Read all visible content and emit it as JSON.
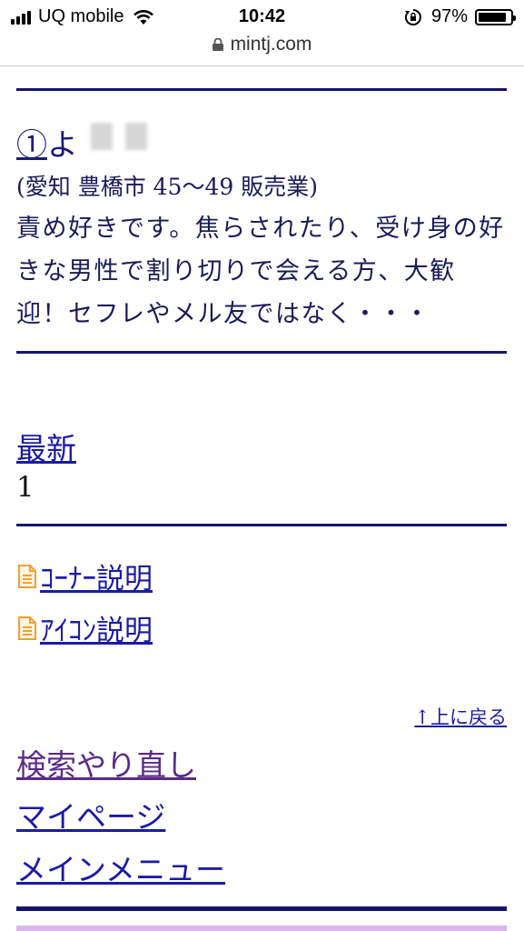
{
  "status_bar": {
    "carrier": "UQ mobile",
    "time": "10:42",
    "battery_percent": "97%",
    "battery_level": 0.97,
    "icons": [
      "signal-icon",
      "wifi-icon",
      "rotation-lock-icon",
      "battery-icon"
    ]
  },
  "browser": {
    "url": "mintj.com",
    "icon": "padlock-icon"
  },
  "profile": {
    "number": "①",
    "name_visible": "よ",
    "meta": "(愛知 豊橋市 45〜49 販売業)",
    "description": "責め好きです。焦らされたり、受け身の好きな男性で割り切りで会える方、大歓迎！セフレやメル友ではなく・・・"
  },
  "pagination": {
    "latest_label": "最新",
    "page": "1"
  },
  "help_links": {
    "corner": "ｺｰﾅｰ説明",
    "icon": "ｱｲｺﾝ説明"
  },
  "back_to_top": "↑上に戻る",
  "nav": {
    "search_again": "検索やり直し",
    "my_page": "マイページ",
    "main_menu": "メインメニュー"
  },
  "colors": {
    "divider": "#14146e",
    "link": "#1a1aaa",
    "visited": "#5a2a8a",
    "text": "#1a1a5a",
    "doc_icon": "#f0a030"
  }
}
